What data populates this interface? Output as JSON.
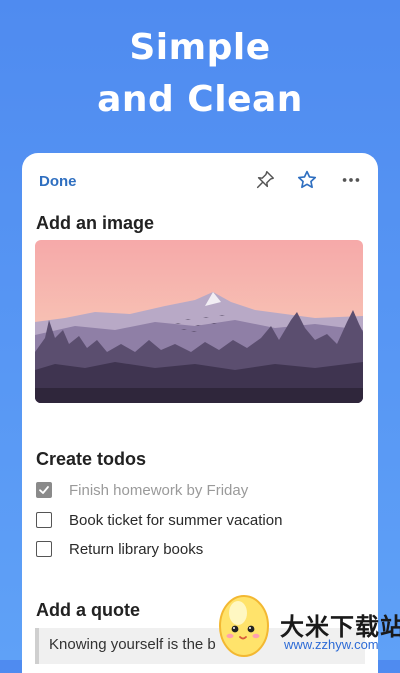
{
  "promo": {
    "headline_line1": "Simple",
    "headline_line2": "and Clean"
  },
  "toolbar": {
    "done_label": "Done",
    "icons": [
      "pin-icon",
      "star-icon",
      "more-icon"
    ],
    "accent_color": "#2f6fc0"
  },
  "note": {
    "image_heading": "Add an image",
    "todos_heading": "Create todos",
    "todos": [
      {
        "label": "Finish homework by Friday",
        "checked": true
      },
      {
        "label": "Book ticket for summer vacation",
        "checked": false
      },
      {
        "label": "Return library books",
        "checked": false
      }
    ],
    "quote_heading": "Add a quote",
    "quote_text": "Knowing yourself is the b"
  },
  "watermark": {
    "title": "大米下载站",
    "url": "www.zzhyw.com"
  },
  "colors": {
    "background": "#5296f3",
    "card": "#ffffff",
    "checked_box": "#8a8a8a"
  }
}
